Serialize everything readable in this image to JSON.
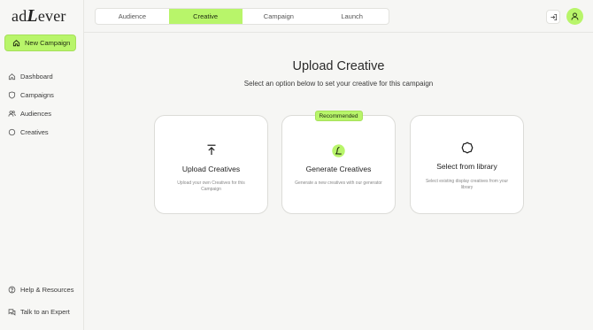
{
  "brand": {
    "prefix": "ad",
    "big": "L",
    "suffix": "ever"
  },
  "sidebar": {
    "new_campaign": "New Campaign",
    "items": [
      {
        "label": "Dashboard",
        "icon": "home-icon"
      },
      {
        "label": "Campaigns",
        "icon": "shield-icon"
      },
      {
        "label": "Audiences",
        "icon": "users-icon"
      },
      {
        "label": "Creatives",
        "icon": "circle-icon"
      }
    ],
    "footer": [
      {
        "label": "Help & Resources",
        "icon": "help-circle-icon"
      },
      {
        "label": "Talk to an Expert",
        "icon": "chat-icon"
      }
    ]
  },
  "tabs": [
    "Audience",
    "Creative",
    "Campaign",
    "Launch"
  ],
  "active_tab": "Creative",
  "main": {
    "title": "Upload Creative",
    "subtitle": "Select an option below to set your creative for this campaign"
  },
  "cards": [
    {
      "title": "Upload Creatives",
      "description": "Upload your own Creatives for this Campaign",
      "icon": "upload-icon"
    },
    {
      "title": "Generate Creatives",
      "description": "Generate a new creatives with our generator",
      "icon": "adlever-generate-icon",
      "badge": "Recommended"
    },
    {
      "title": "Select from library",
      "description": "Select existing display creatives from your library",
      "icon": "library-icon"
    }
  ],
  "colors": {
    "accent": "#b8f56a",
    "background": "#f6f6f4",
    "card": "#ffffff"
  }
}
